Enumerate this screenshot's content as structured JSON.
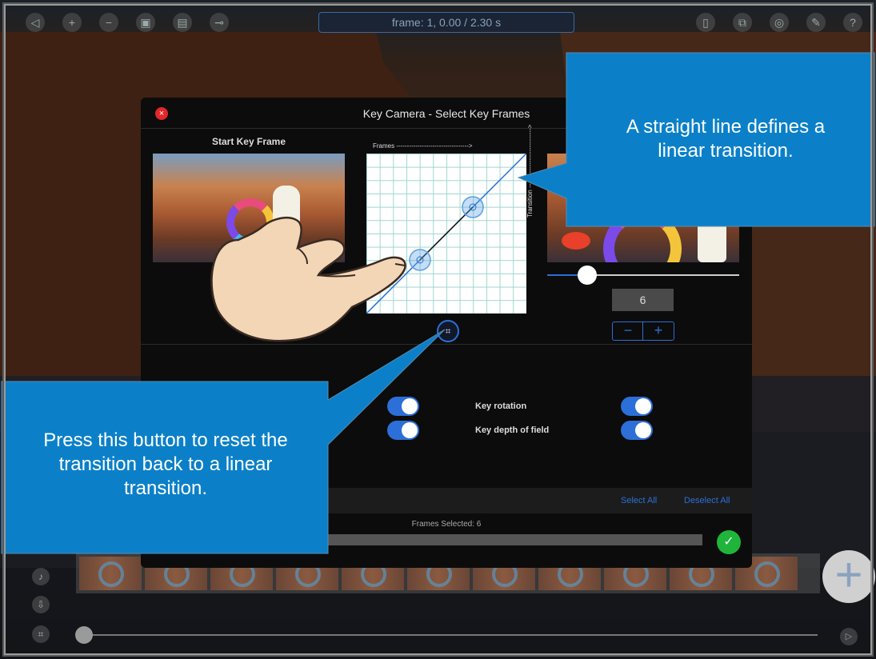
{
  "toolbar": {
    "frame_readout": "frame: 1, 0.00 / 2.30 s",
    "left_icons": [
      "back-icon",
      "plus-icon",
      "minus-icon",
      "camera-icon",
      "film-icon",
      "key-icon"
    ],
    "right_icons": [
      "clipboard-icon",
      "layers-icon",
      "settings-icon",
      "wrench-icon",
      "help-icon"
    ]
  },
  "dialog": {
    "title": "Key Camera - Select Key Frames",
    "start_label": "Start Key Frame",
    "graph": {
      "x_axis_label": "Frames ---------------------------------->",
      "y_axis_label": "Transition ---------------------------->"
    },
    "frame_count": "6",
    "frame_slider": {
      "value_fraction": 0.21
    },
    "stepper": {
      "minus": "−",
      "plus": "+"
    },
    "options": {
      "key_rotation": "Key rotation",
      "key_depth_of_field": "Key depth of field"
    },
    "select_all": "Select All",
    "deselect_all": "Deselect All",
    "frames_selected": "Frames Selected: 6",
    "ok_icon": "✓"
  },
  "callouts": {
    "linear": "A straight line defines a linear transition.",
    "reset": "Press this button to reset the transition back to a linear transition."
  },
  "colors": {
    "accent": "#2c6fd8",
    "callout": "#0b80c8",
    "close": "#e2262b",
    "ok": "#1fb53a"
  }
}
